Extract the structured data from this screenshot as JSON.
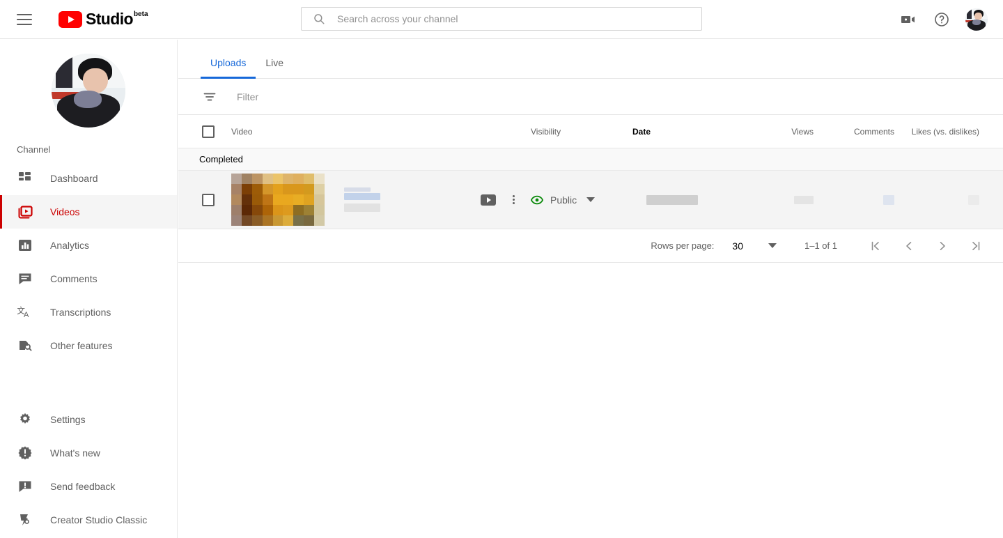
{
  "app": {
    "brand_name": "Studio",
    "brand_beta": "beta",
    "menu_icon": "hamburger-menu-icon",
    "logo_icon": "youtube-logo-icon"
  },
  "search": {
    "placeholder": "Search across your channel",
    "value": "",
    "icon": "search-icon"
  },
  "header_actions": {
    "create_video_label": "create-video-icon",
    "help_label": "help-icon",
    "avatar_label": "account-avatar"
  },
  "sidebar": {
    "section_label": "Channel",
    "avatar_label": "channel-avatar",
    "items": [
      {
        "label": "Dashboard",
        "icon": "dashboard-icon",
        "active": false
      },
      {
        "label": "Videos",
        "icon": "videos-icon",
        "active": true
      },
      {
        "label": "Analytics",
        "icon": "analytics-icon",
        "active": false
      },
      {
        "label": "Comments",
        "icon": "comments-icon",
        "active": false
      },
      {
        "label": "Transcriptions",
        "icon": "transcriptions-icon",
        "active": false
      },
      {
        "label": "Other features",
        "icon": "other-features-icon",
        "active": false
      }
    ],
    "bottom_items": [
      {
        "label": "Settings",
        "icon": "gear-icon"
      },
      {
        "label": "What's new",
        "icon": "whats-new-icon"
      },
      {
        "label": "Send feedback",
        "icon": "send-feedback-icon"
      },
      {
        "label": "Creator Studio Classic",
        "icon": "creator-studio-classic-icon"
      }
    ]
  },
  "main": {
    "tabs": [
      {
        "label": "Uploads",
        "active": true
      },
      {
        "label": "Live",
        "active": false
      }
    ],
    "filter": {
      "placeholder": "Filter",
      "icon": "filter-icon"
    },
    "table": {
      "columns": [
        {
          "label": "Video",
          "sorted": false
        },
        {
          "label": "Visibility",
          "sorted": false
        },
        {
          "label": "Date",
          "sorted": true
        },
        {
          "label": "Views",
          "sorted": false
        },
        {
          "label": "Comments",
          "sorted": false
        },
        {
          "label": "Likes (vs. dislikes)",
          "sorted": false
        }
      ],
      "group_label": "Completed",
      "rows": [
        {
          "title": "",
          "title_redacted": true,
          "thumbnail_redacted": true,
          "visibility": "Public",
          "visibility_icon": "public-eye-icon",
          "visibility_color": "#0b8a0b",
          "date": "",
          "date_redacted": true,
          "views": "",
          "views_redacted": true,
          "comments": "",
          "comments_redacted": true,
          "likes": "",
          "likes_redacted": true,
          "actions": [
            "watch-on-youtube-icon",
            "options-kebab-icon"
          ]
        }
      ]
    },
    "footer": {
      "rows_per_page_label": "Rows per page:",
      "rows_per_page_value": "30",
      "range_label": "1–1 of 1",
      "pager": [
        "first-page-icon",
        "previous-page-icon",
        "next-page-icon",
        "last-page-icon"
      ]
    }
  },
  "colors": {
    "brand_red": "#ff0000",
    "active_red": "#cc0000",
    "tab_blue": "#1668d9",
    "public_green": "#0b8a0b",
    "text_secondary": "#606060"
  },
  "thumbnail_pixels": [
    "#b7a498",
    "#a08263",
    "#bc9463",
    "#e0c083",
    "#ebc46a",
    "#deb46a",
    "#dfb05f",
    "#e0bd6a",
    "#eae1c8",
    "#a78267",
    "#7c3f06",
    "#9d5c08",
    "#d4962a",
    "#e3a11d",
    "#d9971c",
    "#d9971c",
    "#d39a1e",
    "#ded0a5",
    "#b2895e",
    "#64300a",
    "#9a5a08",
    "#bf7516",
    "#e9a81f",
    "#e9a81f",
    "#e8ad24",
    "#dfa321",
    "#d6c69a",
    "#9e7f6b",
    "#5c2806",
    "#86480a",
    "#ad6408",
    "#db9519",
    "#dd9a1e",
    "#8e6d22",
    "#9d8134",
    "#d2c69d",
    "#9c8378",
    "#734825",
    "#8a5c26",
    "#ab7424",
    "#c99833",
    "#dcac3b",
    "#787049",
    "#79693f",
    "#d2c9a6"
  ]
}
